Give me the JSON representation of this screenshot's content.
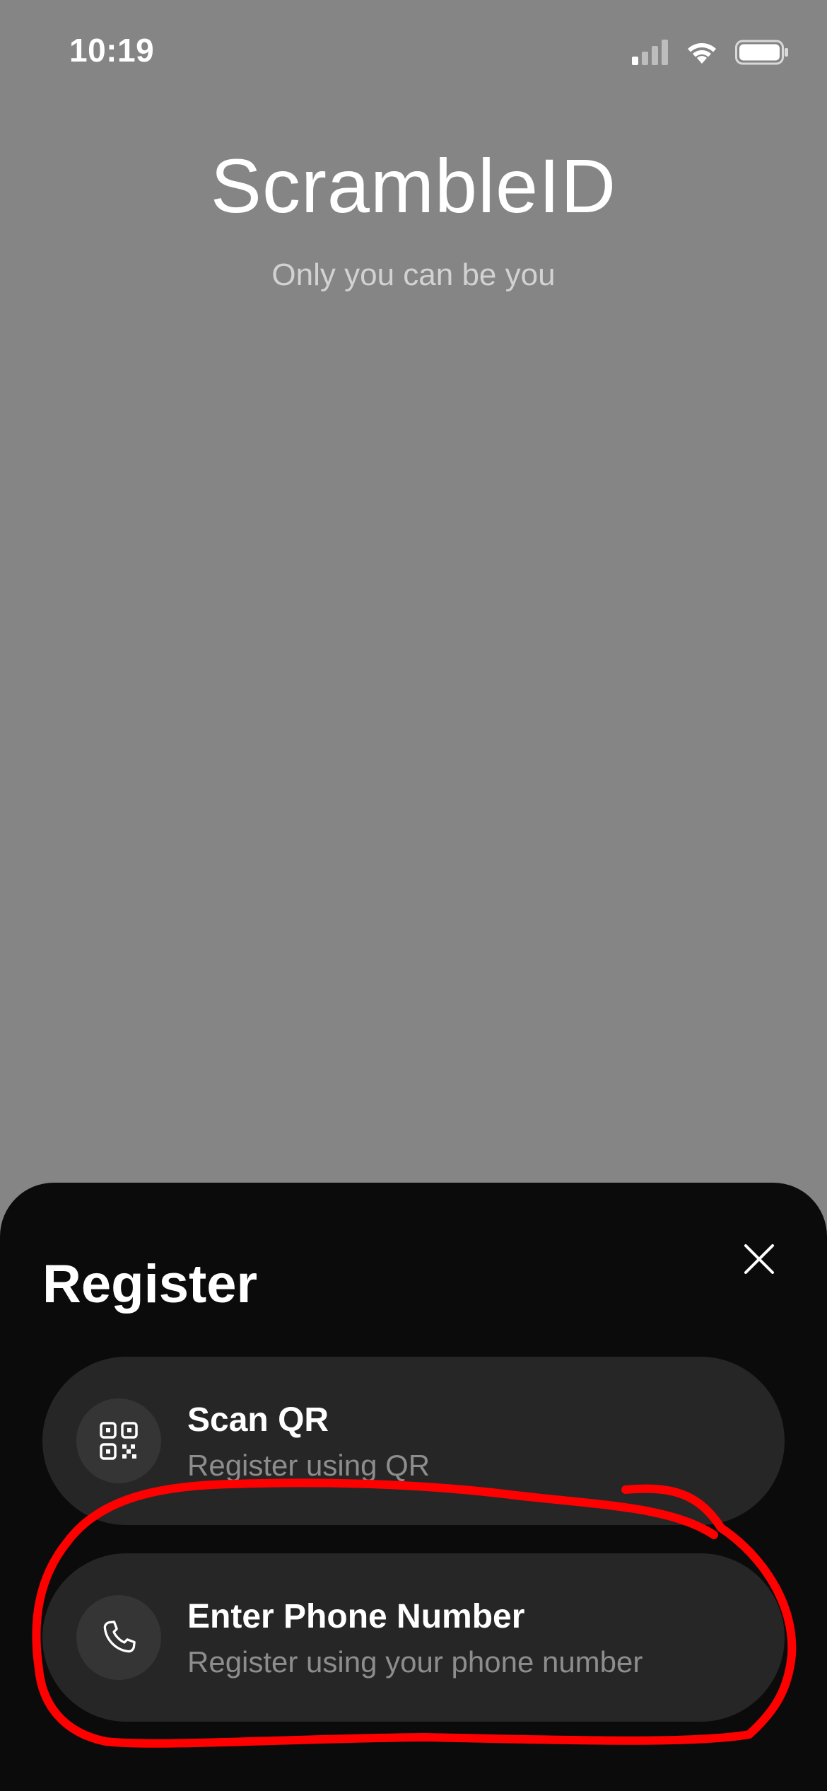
{
  "status_bar": {
    "time": "10:19",
    "icons": [
      "signal-icon",
      "wifi-icon",
      "battery-icon"
    ]
  },
  "hero": {
    "title": "ScrambleID",
    "tagline": "Only you can be you"
  },
  "sheet": {
    "title": "Register",
    "close_icon": "close-icon",
    "options": [
      {
        "icon": "qr-code-icon",
        "label": "Scan QR",
        "subtitle": "Register using QR"
      },
      {
        "icon": "phone-icon",
        "label": "Enter Phone Number",
        "subtitle": "Register using your phone number"
      }
    ]
  },
  "colors": {
    "background": "#858585",
    "sheet": "#0b0b0b",
    "option_card": "#262626",
    "icon_circle": "#353535",
    "subtitle": "#8d8d8d",
    "annotation": "#ff0000"
  }
}
